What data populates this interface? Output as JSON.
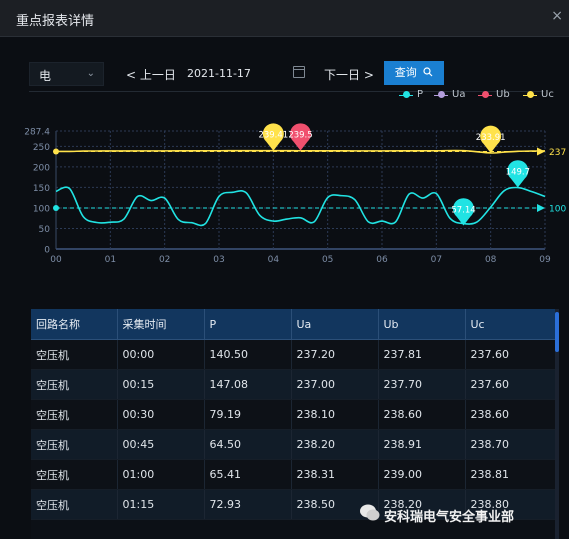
{
  "window": {
    "title": "重点报表详情",
    "close_icon": "×"
  },
  "toolbar": {
    "type_select": "电",
    "prev_label": "上一日",
    "date_value": "2021-11-17",
    "next_label": "下一日",
    "query_label": "查询"
  },
  "legend": [
    {
      "name": "P",
      "color": "#21e3e3"
    },
    {
      "name": "Ua",
      "color": "#b39ddb"
    },
    {
      "name": "Ub",
      "color": "#f0506e"
    },
    {
      "name": "Uc",
      "color": "#ffe24b"
    }
  ],
  "chart_data": {
    "type": "line",
    "x_ticks": [
      "00",
      "01",
      "02",
      "03",
      "04",
      "05",
      "06",
      "07",
      "08",
      "09"
    ],
    "y_ticks": [
      "0",
      "50",
      "100",
      "150",
      "200",
      "250",
      "287.4"
    ],
    "ylim": [
      0,
      287.4
    ],
    "xlim": [
      0,
      9
    ],
    "grid": true,
    "series": [
      {
        "name": "P",
        "color": "#21e3e3",
        "x": [
          0,
          0.25,
          0.5,
          0.75,
          1,
          1.25,
          1.5,
          1.75,
          2,
          2.25,
          2.5,
          2.75,
          3,
          3.25,
          3.5,
          3.75,
          4,
          4.25,
          4.5,
          4.75,
          5,
          5.25,
          5.5,
          5.75,
          6,
          6.25,
          6.5,
          6.75,
          7,
          7.25,
          7.5,
          7.75,
          8,
          8.25,
          8.5,
          8.75,
          9
        ],
        "values": [
          140.5,
          147.08,
          79.19,
          64.5,
          65.41,
          72.93,
          128,
          118,
          124,
          72,
          64,
          62,
          128,
          138,
          137,
          82,
          68,
          73,
          76,
          66,
          125,
          130,
          120,
          66,
          68,
          66,
          134,
          124,
          135,
          75,
          62,
          66,
          102,
          142,
          149.7,
          140,
          128
        ]
      },
      {
        "name": "Uc",
        "color": "#ffe24b",
        "x": [
          0,
          0.25,
          0.5,
          0.75,
          1,
          1.5,
          2,
          2.5,
          3,
          3.5,
          4,
          4.5,
          5,
          5.5,
          6,
          6.5,
          7,
          7.5,
          8,
          8.25,
          8.5,
          8.75,
          9
        ],
        "values": [
          237.6,
          237.6,
          238.6,
          238.7,
          238.81,
          239,
          239,
          239.2,
          239.3,
          239.4,
          239.41,
          239.3,
          239.1,
          239,
          239,
          239.1,
          239.3,
          239.5,
          233.91,
          236,
          238,
          238.5,
          239
        ]
      }
    ],
    "annotations": [
      {
        "series": "Uc",
        "type": "max",
        "label": "239.41",
        "x": 4.0,
        "y": 239.41,
        "color": "#ffe24b"
      },
      {
        "series": "Ub",
        "type": "max",
        "label": "239.5",
        "x": 4.5,
        "y": 239.5,
        "color": "#f0506e"
      },
      {
        "series": "Uc",
        "type": "min",
        "label": "233.91",
        "x": 8.0,
        "y": 233.91,
        "color": "#ffe24b"
      },
      {
        "series": "P",
        "type": "max",
        "label": "149.7",
        "x": 8.5,
        "y": 149.7,
        "color": "#21e3e3"
      },
      {
        "series": "P",
        "type": "min",
        "label": "57.14",
        "x": 7.5,
        "y": 57.14,
        "color": "#21e3e3"
      }
    ],
    "mark_lines": [
      {
        "series": "Uc",
        "label": "237",
        "y": 237.5,
        "color": "#ffe24b"
      },
      {
        "series": "P",
        "label": "100",
        "y": 100,
        "color": "#21e3e3"
      }
    ]
  },
  "table": {
    "columns": [
      "回路名称",
      "采集时间",
      "P",
      "Ua",
      "Ub",
      "Uc"
    ],
    "rows": [
      [
        "空压机",
        "00:00",
        "140.50",
        "237.20",
        "237.81",
        "237.60"
      ],
      [
        "空压机",
        "00:15",
        "147.08",
        "237.00",
        "237.70",
        "237.60"
      ],
      [
        "空压机",
        "00:30",
        "79.19",
        "238.10",
        "238.60",
        "238.60"
      ],
      [
        "空压机",
        "00:45",
        "64.50",
        "238.20",
        "238.91",
        "238.70"
      ],
      [
        "空压机",
        "01:00",
        "65.41",
        "238.31",
        "239.00",
        "238.81"
      ],
      [
        "空压机",
        "01:15",
        "72.93",
        "238.50",
        "238.20",
        "238.80"
      ]
    ]
  },
  "watermark": {
    "text": "安科瑞电气安全事业部"
  }
}
